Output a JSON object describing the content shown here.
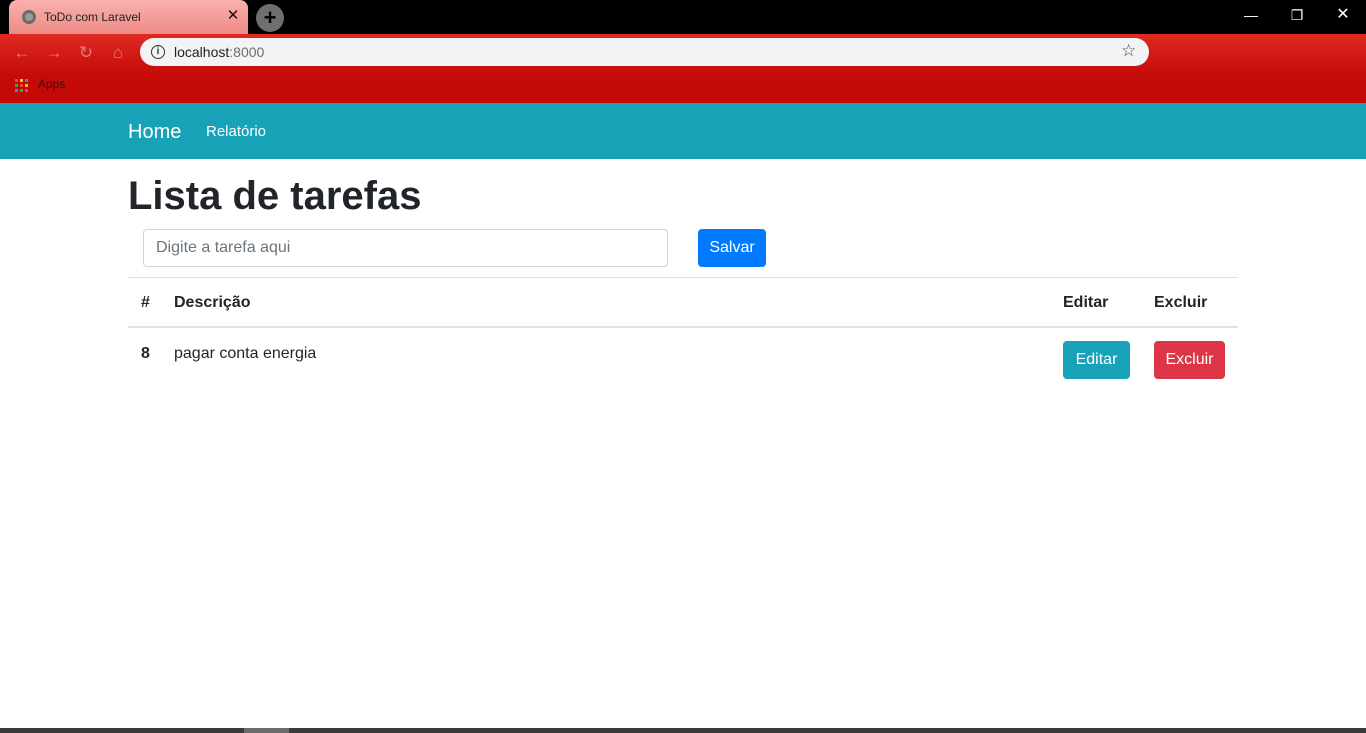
{
  "browser": {
    "tab_title": "ToDo com Laravel",
    "tab_close": "✕",
    "new_tab": "+",
    "url_host": "localhost",
    "url_port": ":8000",
    "bookmark_apps": "Apps",
    "icons": {
      "back": "arrow-left-icon",
      "forward": "arrow-right-icon",
      "reload": "reload-icon",
      "home": "home-icon",
      "info": "info-icon",
      "star": "star-icon",
      "apps": "apps-grid-icon"
    },
    "window_controls": {
      "minimize": "—",
      "maximize": "❐",
      "close": "✕"
    },
    "colors": {
      "toolbar": "#c50b07",
      "tab": "#f5a19d"
    }
  },
  "navbar": {
    "home_label": "Home",
    "link_label": "Relatório",
    "color": "#17a2b8"
  },
  "page": {
    "title": "Lista de tarefas",
    "input_placeholder": "Digite a tarefa aqui",
    "input_value": "",
    "save_label": "Salvar"
  },
  "table": {
    "headers": {
      "id": "#",
      "description": "Descrição",
      "edit": "Editar",
      "delete": "Excluir"
    },
    "rows": [
      {
        "id": "8",
        "description": "pagar conta energia",
        "edit_label": "Editar",
        "delete_label": "Excluir"
      }
    ]
  },
  "colors": {
    "primary": "#007bff",
    "info": "#17a2b8",
    "danger": "#dc3545"
  }
}
